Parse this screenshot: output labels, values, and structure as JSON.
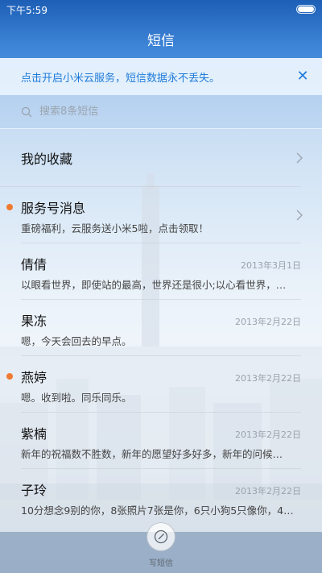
{
  "status_bar": {
    "time": "下午5:59"
  },
  "header": {
    "title": "短信"
  },
  "banner": {
    "text": "点击开启小米云服务，短信数据永不丢失。"
  },
  "search": {
    "placeholder": "搜索8条短信"
  },
  "favorites": {
    "label": "我的收藏"
  },
  "messages": [
    {
      "name": "服务号消息",
      "preview": "重磅福利，云服务送小米5啦，点击领取！",
      "date": "",
      "unread": true
    },
    {
      "name": "倩倩",
      "preview": "以眼看世界，即使站的最高，世界还是很小;以心看世界，…",
      "date": "2013年3月1日",
      "unread": false
    },
    {
      "name": "果冻",
      "preview": "嗯，今天会回去的早点。",
      "date": "2013年2月22日",
      "unread": false
    },
    {
      "name": "燕婷",
      "preview": "嗯。收到啦。同乐同乐。",
      "date": "2013年2月22日",
      "unread": true
    },
    {
      "name": "紫楠",
      "preview": "新年的祝福数不胜数，新年的愿望好多好多，新年的问候…",
      "date": "2013年2月22日",
      "unread": false
    },
    {
      "name": "子玲",
      "preview": "10分想念9别的你，8张照片7张是你，6只小狗5只像你，4…",
      "date": "2013年2月22日",
      "unread": false
    }
  ],
  "compose": {
    "label": "写短信"
  },
  "colors": {
    "accent": "#1f7ad9",
    "unread_dot": "#f07a30"
  }
}
